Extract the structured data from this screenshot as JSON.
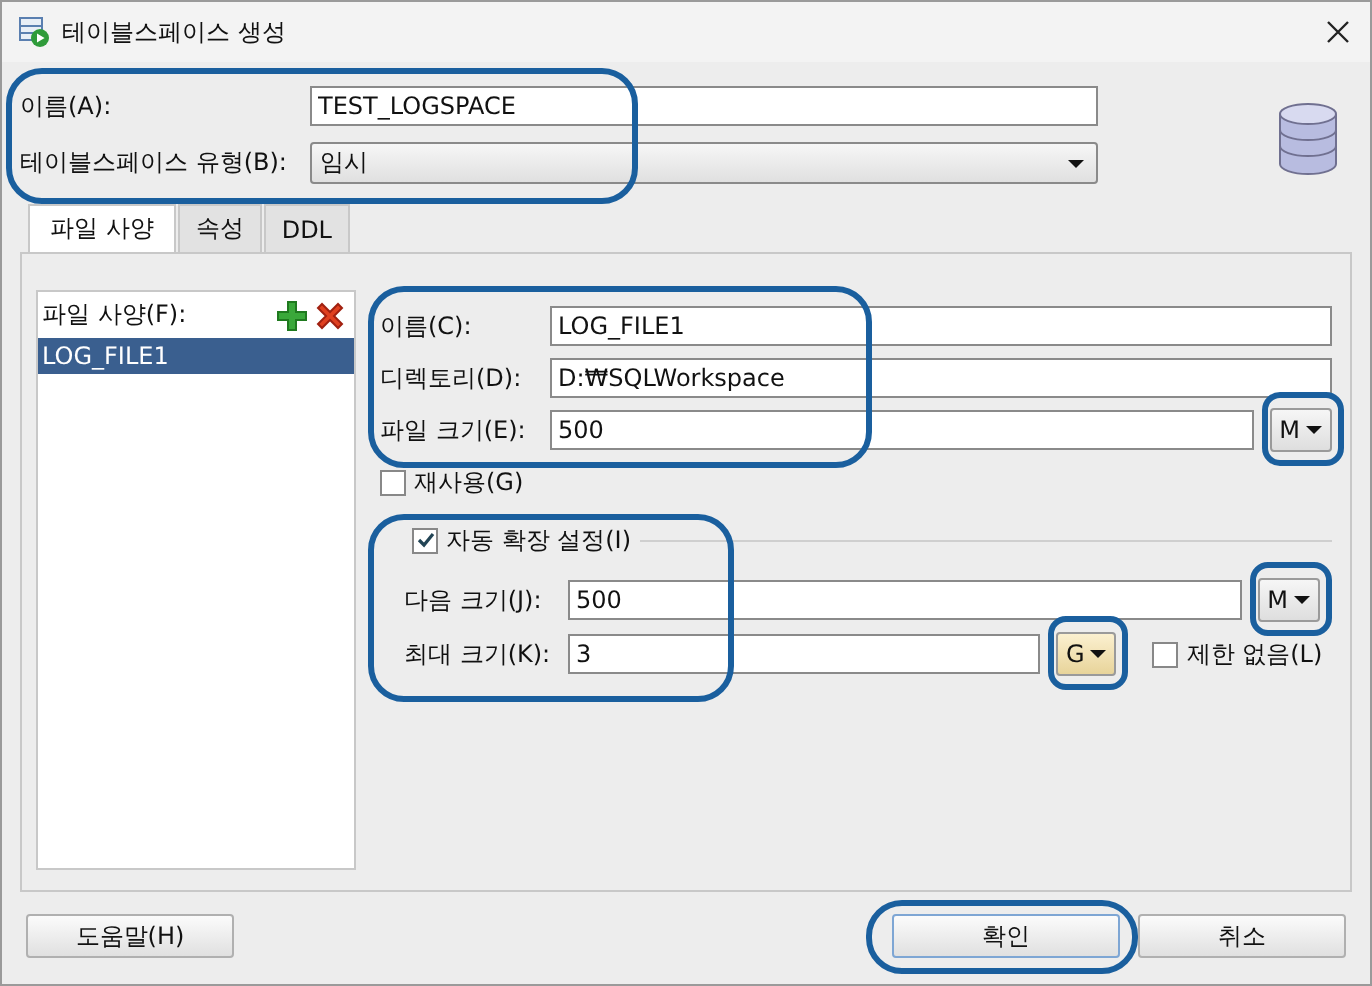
{
  "window": {
    "title": "테이블스페이스 생성"
  },
  "name_field": {
    "label": "이름(A):",
    "value": "TEST_LOGSPACE"
  },
  "type_field": {
    "label": "테이블스페이스 유형(B):",
    "value": "임시"
  },
  "tabs": [
    {
      "label": "파일 사양",
      "selected": true
    },
    {
      "label": "속성",
      "selected": false
    },
    {
      "label": "DDL",
      "selected": false
    }
  ],
  "file_list": {
    "label": "파일 사양(F):",
    "items": [
      {
        "label": "LOG_FILE1",
        "selected": true
      }
    ]
  },
  "fields": [
    {
      "label": "이름(C):",
      "value": "LOG_FILE1"
    },
    {
      "label": "디렉토리(D):",
      "value": "D:₩SQLWorkspace"
    },
    {
      "label": "파일 크기(E):",
      "value": "500",
      "unit": "M"
    }
  ],
  "reuse": {
    "label": "재사용(G)",
    "checked": false
  },
  "autoextend": {
    "label": "자동 확장 설정(I)",
    "checked": true,
    "next_size": {
      "label": "다음 크기(J):",
      "value": "500",
      "unit": "M",
      "unit_focused": false
    },
    "max_size": {
      "label": "최대 크기(K):",
      "value": "3",
      "unit": "G",
      "unit_focused": true
    },
    "unlimited": {
      "label": "제한 없음(L)",
      "checked": false
    }
  },
  "buttons": [
    {
      "label": "도움말(H)"
    },
    {
      "label": "확인"
    },
    {
      "label": "취소"
    }
  ]
}
